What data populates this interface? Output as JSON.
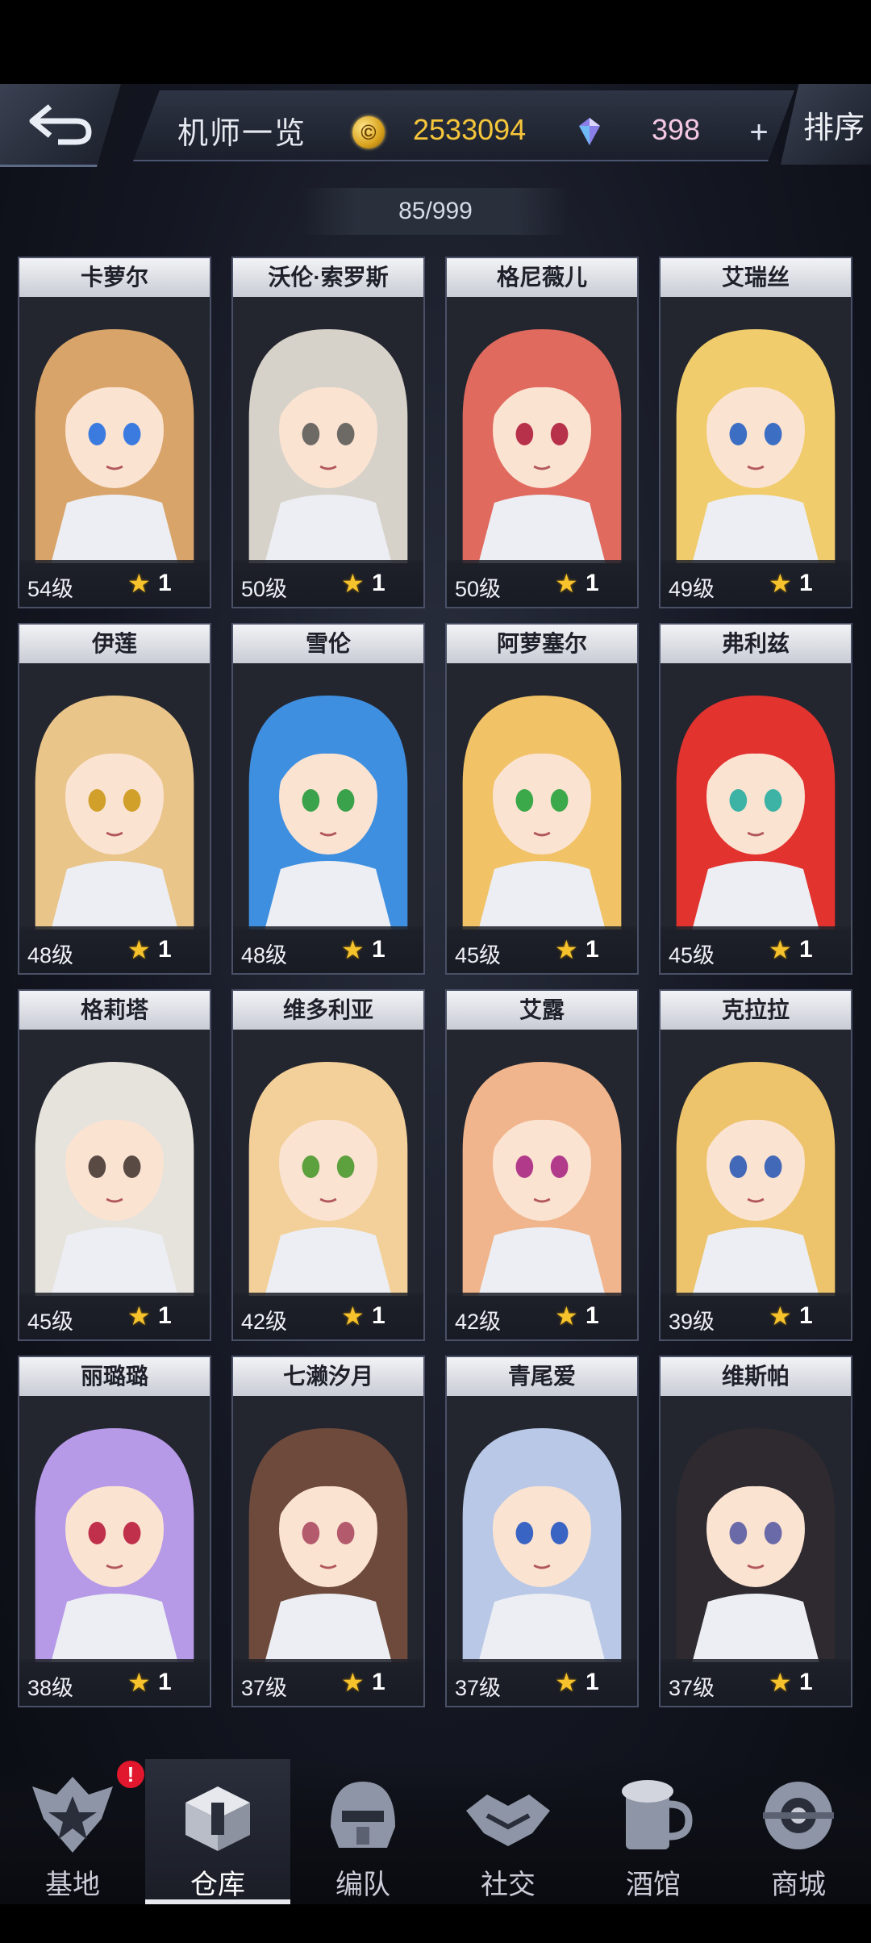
{
  "header": {
    "title": "机师一览",
    "coin_value": "2533094",
    "gem_value": "398",
    "plus_label": "+",
    "sort_label": "排序",
    "pilot_count": "85/999"
  },
  "colors": {
    "coin": "#f5c53a",
    "gem_text": "#f5c9e3",
    "star": "#f6c32c",
    "alert": "#e0172d"
  },
  "pilots": [
    {
      "name": "卡萝尔",
      "level": "54级",
      "stars": "1",
      "hair": "#d9a46a",
      "eyes": "#3b7be0"
    },
    {
      "name": "沃伦·索罗斯",
      "level": "50级",
      "stars": "1",
      "hair": "#d7d2c9",
      "eyes": "#6d6a66"
    },
    {
      "name": "格尼薇儿",
      "level": "50级",
      "stars": "1",
      "hair": "#e06a5e",
      "eyes": "#b7314a"
    },
    {
      "name": "艾瑞丝",
      "level": "49级",
      "stars": "1",
      "hair": "#f0cc6c",
      "eyes": "#3c6fc4"
    },
    {
      "name": "伊莲",
      "level": "48级",
      "stars": "1",
      "hair": "#e9c58a",
      "eyes": "#d0a02a"
    },
    {
      "name": "雪伦",
      "level": "48级",
      "stars": "1",
      "hair": "#3f8fe0",
      "eyes": "#3aa24a"
    },
    {
      "name": "阿萝塞尔",
      "level": "45级",
      "stars": "1",
      "hair": "#f1c266",
      "eyes": "#3ba84a"
    },
    {
      "name": "弗利兹",
      "level": "45级",
      "stars": "1",
      "hair": "#e2332f",
      "eyes": "#3cb3a5"
    },
    {
      "name": "格莉塔",
      "level": "45级",
      "stars": "1",
      "hair": "#e6e2dc",
      "eyes": "#5a4a44"
    },
    {
      "name": "维多利亚",
      "level": "42级",
      "stars": "1",
      "hair": "#f3d09a",
      "eyes": "#5da03e"
    },
    {
      "name": "艾露",
      "level": "42级",
      "stars": "1",
      "hair": "#f0b58c",
      "eyes": "#b23a8a"
    },
    {
      "name": "克拉拉",
      "level": "39级",
      "stars": "1",
      "hair": "#edc46c",
      "eyes": "#4268b8"
    },
    {
      "name": "丽璐璐",
      "level": "38级",
      "stars": "1",
      "hair": "#b69ae8",
      "eyes": "#c0304a"
    },
    {
      "name": "七濑汐月",
      "level": "37级",
      "stars": "1",
      "hair": "#6e4a3c",
      "eyes": "#b35a6c"
    },
    {
      "name": "青尾爱",
      "level": "37级",
      "stars": "1",
      "hair": "#b8c8e6",
      "eyes": "#3a64c4"
    },
    {
      "name": "维斯帕",
      "level": "37级",
      "stars": "1",
      "hair": "#2e2a30",
      "eyes": "#6a6aa8"
    }
  ],
  "nav": {
    "items": [
      {
        "label": "基地",
        "icon": "base-emblem-icon"
      },
      {
        "label": "仓库",
        "icon": "warehouse-cubes-icon"
      },
      {
        "label": "编队",
        "icon": "mech-helmet-icon"
      },
      {
        "label": "社交",
        "icon": "handshake-icon"
      },
      {
        "label": "酒馆",
        "icon": "beer-mug-icon"
      },
      {
        "label": "商城",
        "icon": "shop-sphere-icon"
      }
    ],
    "active_index": 1,
    "alert_label": "!"
  }
}
